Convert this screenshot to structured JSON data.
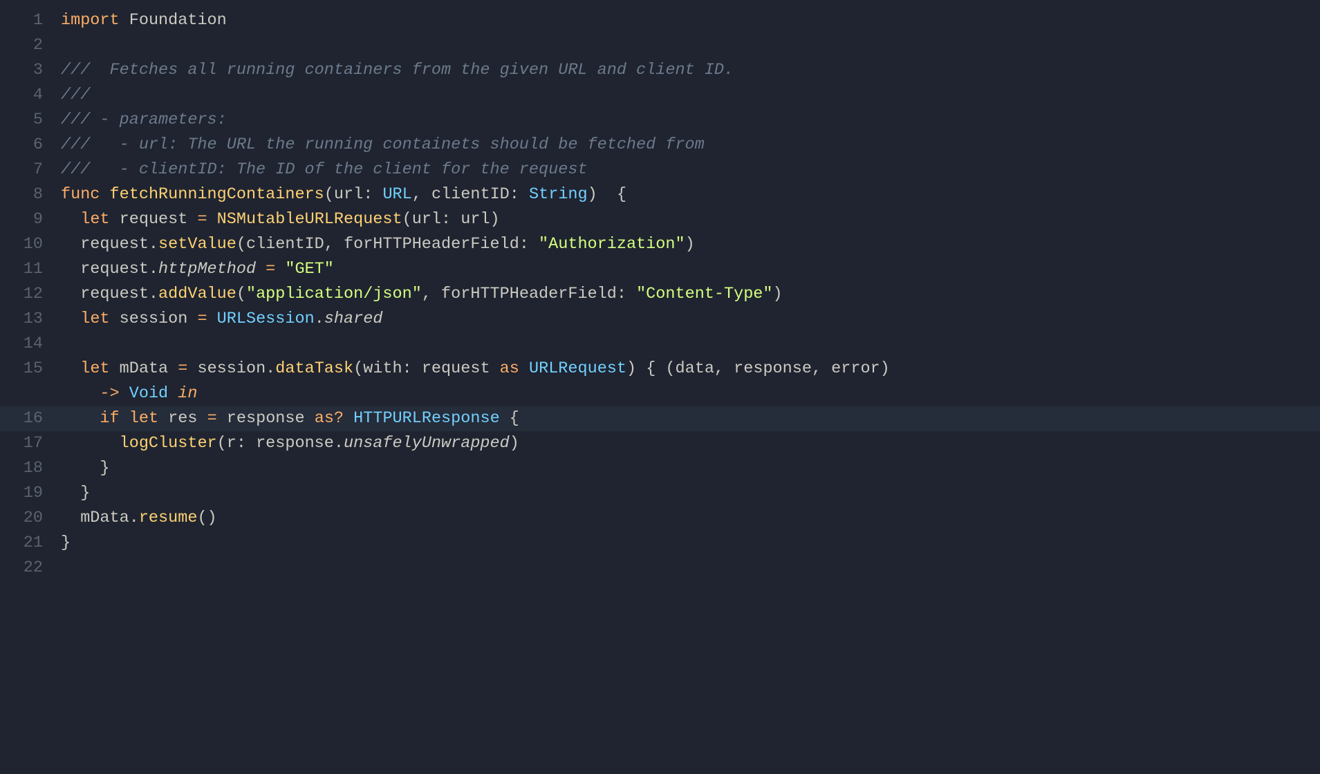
{
  "editor": {
    "highlighted_line": 16,
    "lines": [
      {
        "num": "1",
        "segs": [
          {
            "c": "kw",
            "t": "import"
          },
          {
            "c": "punc",
            "t": " "
          },
          {
            "c": "ident",
            "t": "Foundation"
          }
        ]
      },
      {
        "num": "2",
        "segs": [
          {
            "c": "punc",
            "t": ""
          }
        ]
      },
      {
        "num": "3",
        "segs": [
          {
            "c": "cmt",
            "t": "///  Fetches all running containers from the given URL and client ID."
          }
        ]
      },
      {
        "num": "4",
        "segs": [
          {
            "c": "cmt",
            "t": "///"
          }
        ]
      },
      {
        "num": "5",
        "segs": [
          {
            "c": "cmt",
            "t": "/// - parameters:"
          }
        ]
      },
      {
        "num": "6",
        "segs": [
          {
            "c": "cmt",
            "t": "///   - url: The URL the running containets should be fetched from"
          }
        ]
      },
      {
        "num": "7",
        "segs": [
          {
            "c": "cmt",
            "t": "///   - clientID: The ID of the client for the request"
          }
        ]
      },
      {
        "num": "8",
        "segs": [
          {
            "c": "kw",
            "t": "func"
          },
          {
            "c": "punc",
            "t": " "
          },
          {
            "c": "func",
            "t": "fetchRunningContainers"
          },
          {
            "c": "punc",
            "t": "("
          },
          {
            "c": "ident",
            "t": "url"
          },
          {
            "c": "punc",
            "t": ": "
          },
          {
            "c": "type",
            "t": "URL"
          },
          {
            "c": "punc",
            "t": ", "
          },
          {
            "c": "ident",
            "t": "clientID"
          },
          {
            "c": "punc",
            "t": ": "
          },
          {
            "c": "type",
            "t": "String"
          },
          {
            "c": "punc",
            "t": ")  {"
          }
        ]
      },
      {
        "num": "9",
        "segs": [
          {
            "c": "punc",
            "t": "  "
          },
          {
            "c": "kw",
            "t": "let"
          },
          {
            "c": "punc",
            "t": " request "
          },
          {
            "c": "kw",
            "t": "="
          },
          {
            "c": "punc",
            "t": " "
          },
          {
            "c": "func",
            "t": "NSMutableURLRequest"
          },
          {
            "c": "punc",
            "t": "(url: url)"
          }
        ]
      },
      {
        "num": "10",
        "segs": [
          {
            "c": "punc",
            "t": "  request."
          },
          {
            "c": "func",
            "t": "setValue"
          },
          {
            "c": "punc",
            "t": "(clientID, forHTTPHeaderField: "
          },
          {
            "c": "str",
            "t": "\"Authorization\""
          },
          {
            "c": "punc",
            "t": ")"
          }
        ]
      },
      {
        "num": "11",
        "segs": [
          {
            "c": "punc",
            "t": "  request."
          },
          {
            "c": "prop",
            "t": "httpMethod"
          },
          {
            "c": "punc",
            "t": " "
          },
          {
            "c": "kw",
            "t": "="
          },
          {
            "c": "punc",
            "t": " "
          },
          {
            "c": "str",
            "t": "\"GET\""
          }
        ]
      },
      {
        "num": "12",
        "segs": [
          {
            "c": "punc",
            "t": "  request."
          },
          {
            "c": "func",
            "t": "addValue"
          },
          {
            "c": "punc",
            "t": "("
          },
          {
            "c": "str",
            "t": "\"application/json\""
          },
          {
            "c": "punc",
            "t": ", forHTTPHeaderField: "
          },
          {
            "c": "str",
            "t": "\"Content-Type\""
          },
          {
            "c": "punc",
            "t": ")"
          }
        ]
      },
      {
        "num": "13",
        "segs": [
          {
            "c": "punc",
            "t": "  "
          },
          {
            "c": "kw",
            "t": "let"
          },
          {
            "c": "punc",
            "t": " session "
          },
          {
            "c": "kw",
            "t": "="
          },
          {
            "c": "punc",
            "t": " "
          },
          {
            "c": "type",
            "t": "URLSession"
          },
          {
            "c": "punc",
            "t": "."
          },
          {
            "c": "prop",
            "t": "shared"
          }
        ]
      },
      {
        "num": "14",
        "segs": [
          {
            "c": "punc",
            "t": ""
          }
        ]
      },
      {
        "num": "15",
        "segs": [
          {
            "c": "punc",
            "t": "  "
          },
          {
            "c": "kw",
            "t": "let"
          },
          {
            "c": "punc",
            "t": " mData "
          },
          {
            "c": "kw",
            "t": "="
          },
          {
            "c": "punc",
            "t": " session."
          },
          {
            "c": "func",
            "t": "dataTask"
          },
          {
            "c": "punc",
            "t": "(with: request "
          },
          {
            "c": "kw",
            "t": "as"
          },
          {
            "c": "punc",
            "t": " "
          },
          {
            "c": "type",
            "t": "URLRequest"
          },
          {
            "c": "punc",
            "t": ") { (data, response, error)"
          }
        ]
      },
      {
        "num": "",
        "segs": [
          {
            "c": "punc",
            "t": "    "
          },
          {
            "c": "arrow",
            "t": "->"
          },
          {
            "c": "punc",
            "t": " "
          },
          {
            "c": "type",
            "t": "Void"
          },
          {
            "c": "punc",
            "t": " "
          },
          {
            "c": "kw-i",
            "t": "in"
          }
        ]
      },
      {
        "num": "16",
        "segs": [
          {
            "c": "punc",
            "t": "    "
          },
          {
            "c": "kw",
            "t": "if"
          },
          {
            "c": "punc",
            "t": " "
          },
          {
            "c": "kw",
            "t": "let"
          },
          {
            "c": "punc",
            "t": " res "
          },
          {
            "c": "kw",
            "t": "="
          },
          {
            "c": "punc",
            "t": " response "
          },
          {
            "c": "kw",
            "t": "as?"
          },
          {
            "c": "punc",
            "t": " "
          },
          {
            "c": "type",
            "t": "HTTPURLResponse"
          },
          {
            "c": "punc",
            "t": " {"
          }
        ]
      },
      {
        "num": "17",
        "segs": [
          {
            "c": "punc",
            "t": "      "
          },
          {
            "c": "func",
            "t": "logCluster"
          },
          {
            "c": "punc",
            "t": "(r: response."
          },
          {
            "c": "prop",
            "t": "unsafelyUnwrapped"
          },
          {
            "c": "punc",
            "t": ")"
          }
        ]
      },
      {
        "num": "18",
        "segs": [
          {
            "c": "punc",
            "t": "    }"
          }
        ]
      },
      {
        "num": "19",
        "segs": [
          {
            "c": "punc",
            "t": "  }"
          }
        ]
      },
      {
        "num": "20",
        "segs": [
          {
            "c": "punc",
            "t": "  mData."
          },
          {
            "c": "func",
            "t": "resume"
          },
          {
            "c": "punc",
            "t": "()"
          }
        ]
      },
      {
        "num": "21",
        "segs": [
          {
            "c": "punc",
            "t": "}"
          }
        ]
      },
      {
        "num": "22",
        "segs": [
          {
            "c": "punc",
            "t": ""
          }
        ]
      }
    ]
  }
}
